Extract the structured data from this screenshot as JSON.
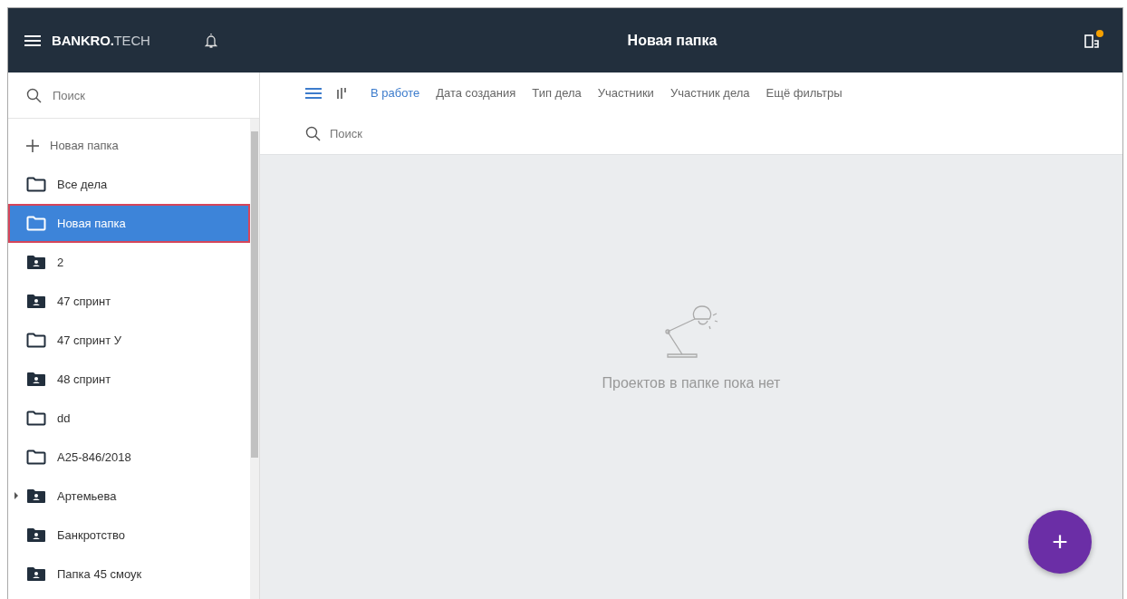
{
  "header": {
    "logo_bold": "BANKRO.",
    "logo_light": "TECH",
    "title": "Новая папка",
    "notification_dot": true
  },
  "sidebar": {
    "search": {
      "placeholder": "Поиск"
    },
    "new_folder": "Новая папка",
    "items": [
      {
        "label": "Все дела",
        "kind": "folder",
        "selected": false
      },
      {
        "label": "Новая папка",
        "kind": "folder",
        "selected": true
      },
      {
        "label": "2",
        "kind": "shared",
        "selected": false
      },
      {
        "label": "47 спринт",
        "kind": "shared",
        "selected": false
      },
      {
        "label": "47 спринт У",
        "kind": "folder",
        "selected": false
      },
      {
        "label": "48 спринт",
        "kind": "shared",
        "selected": false
      },
      {
        "label": "dd",
        "kind": "folder",
        "selected": false
      },
      {
        "label": "А25-846/2018",
        "kind": "folder",
        "selected": false
      },
      {
        "label": "Артемьева",
        "kind": "shared",
        "selected": false,
        "expanded": false
      },
      {
        "label": "Банкротство",
        "kind": "shared",
        "selected": false
      },
      {
        "label": "Папка 45 смоук",
        "kind": "shared",
        "selected": false
      }
    ]
  },
  "toolbar": {
    "views": [
      {
        "kind": "list",
        "selected": true
      },
      {
        "kind": "columns",
        "selected": false
      }
    ],
    "filters": [
      {
        "label": "В работе",
        "selected": true
      },
      {
        "label": "Дата создания",
        "selected": false
      },
      {
        "label": "Тип дела",
        "selected": false
      },
      {
        "label": "Участники",
        "selected": false
      },
      {
        "label": "Участник дела",
        "selected": false
      },
      {
        "label": "Ещё фильтры",
        "selected": false
      }
    ],
    "search": {
      "placeholder": "Поиск"
    }
  },
  "empty_state": {
    "message": "Проектов в папке пока нет"
  },
  "fab": {
    "label": "+"
  }
}
